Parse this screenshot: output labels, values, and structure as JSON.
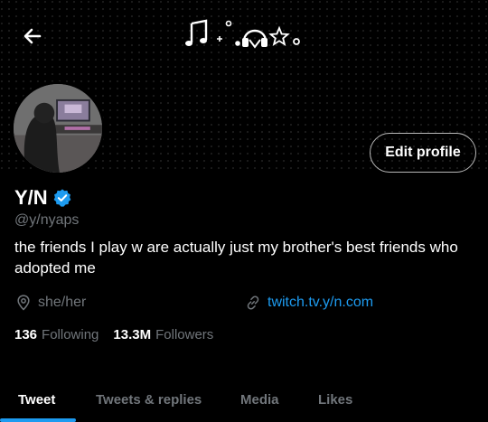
{
  "header": {
    "back_icon": "arrow-left-icon",
    "banner_icons": [
      "music-notes-icon",
      "sparkle-icon",
      "headphones-icon",
      "star-icon"
    ]
  },
  "profile": {
    "edit_button_label": "Edit profile",
    "display_name": "Y/N",
    "verified_icon": "verified-badge-icon",
    "handle": "@y/nyaps",
    "bio": "the friends I play w are actually just my brother's best friends who adopted me",
    "pronouns": "she/her",
    "pronouns_icon": "location-pin-icon",
    "link": "twitch.tv.y/n.com",
    "link_icon": "link-icon"
  },
  "stats": {
    "following_count": "136",
    "following_label": "Following",
    "followers_count": "13.3M",
    "followers_label": "Followers"
  },
  "tabs": [
    {
      "label": "Tweet",
      "active": true
    },
    {
      "label": "Tweets & replies",
      "active": false
    },
    {
      "label": "Media",
      "active": false
    },
    {
      "label": "Likes",
      "active": false
    }
  ],
  "colors": {
    "background": "#000000",
    "accent": "#1d9bf0",
    "secondary_text": "#71767b",
    "primary_text": "#ffffff"
  }
}
